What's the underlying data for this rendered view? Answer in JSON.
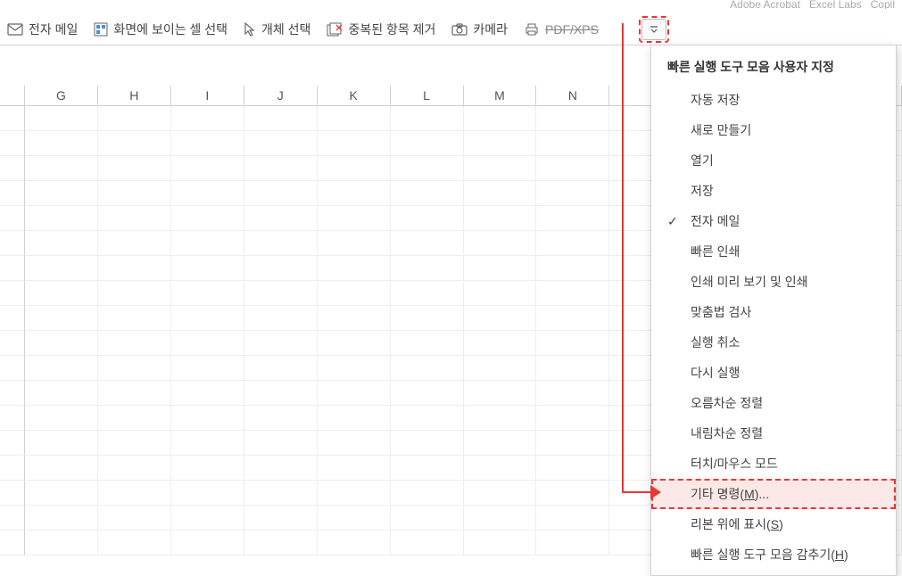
{
  "ribbon_fragments": {
    "right": [
      "Adobe Acrobat",
      "Excel Labs",
      "Copil"
    ]
  },
  "toolbar": {
    "email": "전자 메일",
    "select_visible": "화면에 보이는 셀 선택",
    "select_objects": "개체 선택",
    "remove_dup": "중복된 항목 제거",
    "camera": "카메라",
    "pdf_xps": "PDF/XPS"
  },
  "columns": [
    "G",
    "H",
    "I",
    "J",
    "K",
    "L",
    "M",
    "N",
    "",
    "",
    "",
    "",
    ""
  ],
  "menu": {
    "title": "빠른 실행 도구 모음 사용자 지정",
    "items": [
      {
        "label": "자동 저장",
        "checked": false
      },
      {
        "label": "새로 만들기",
        "checked": false
      },
      {
        "label": "열기",
        "checked": false
      },
      {
        "label": "저장",
        "checked": false
      },
      {
        "label": "전자 메일",
        "checked": true
      },
      {
        "label": "빠른 인쇄",
        "checked": false
      },
      {
        "label": "인쇄 미리 보기 및 인쇄",
        "checked": false
      },
      {
        "label": "맞춤법 검사",
        "checked": false
      },
      {
        "label": "실행 취소",
        "checked": false
      },
      {
        "label": "다시 실행",
        "checked": false
      },
      {
        "label": "오름차순 정렬",
        "checked": false
      },
      {
        "label": "내림차순 정렬",
        "checked": false
      },
      {
        "label": "터치/마우스 모드",
        "checked": false
      },
      {
        "label": "기타 명령(M)...",
        "checked": false,
        "highlighted": true,
        "underline": "M"
      },
      {
        "label": "리본 위에 표시(S)",
        "checked": false,
        "underline": "S"
      },
      {
        "label": "빠른 실행 도구 모음 감추기(H)",
        "checked": false,
        "underline": "H"
      }
    ]
  }
}
